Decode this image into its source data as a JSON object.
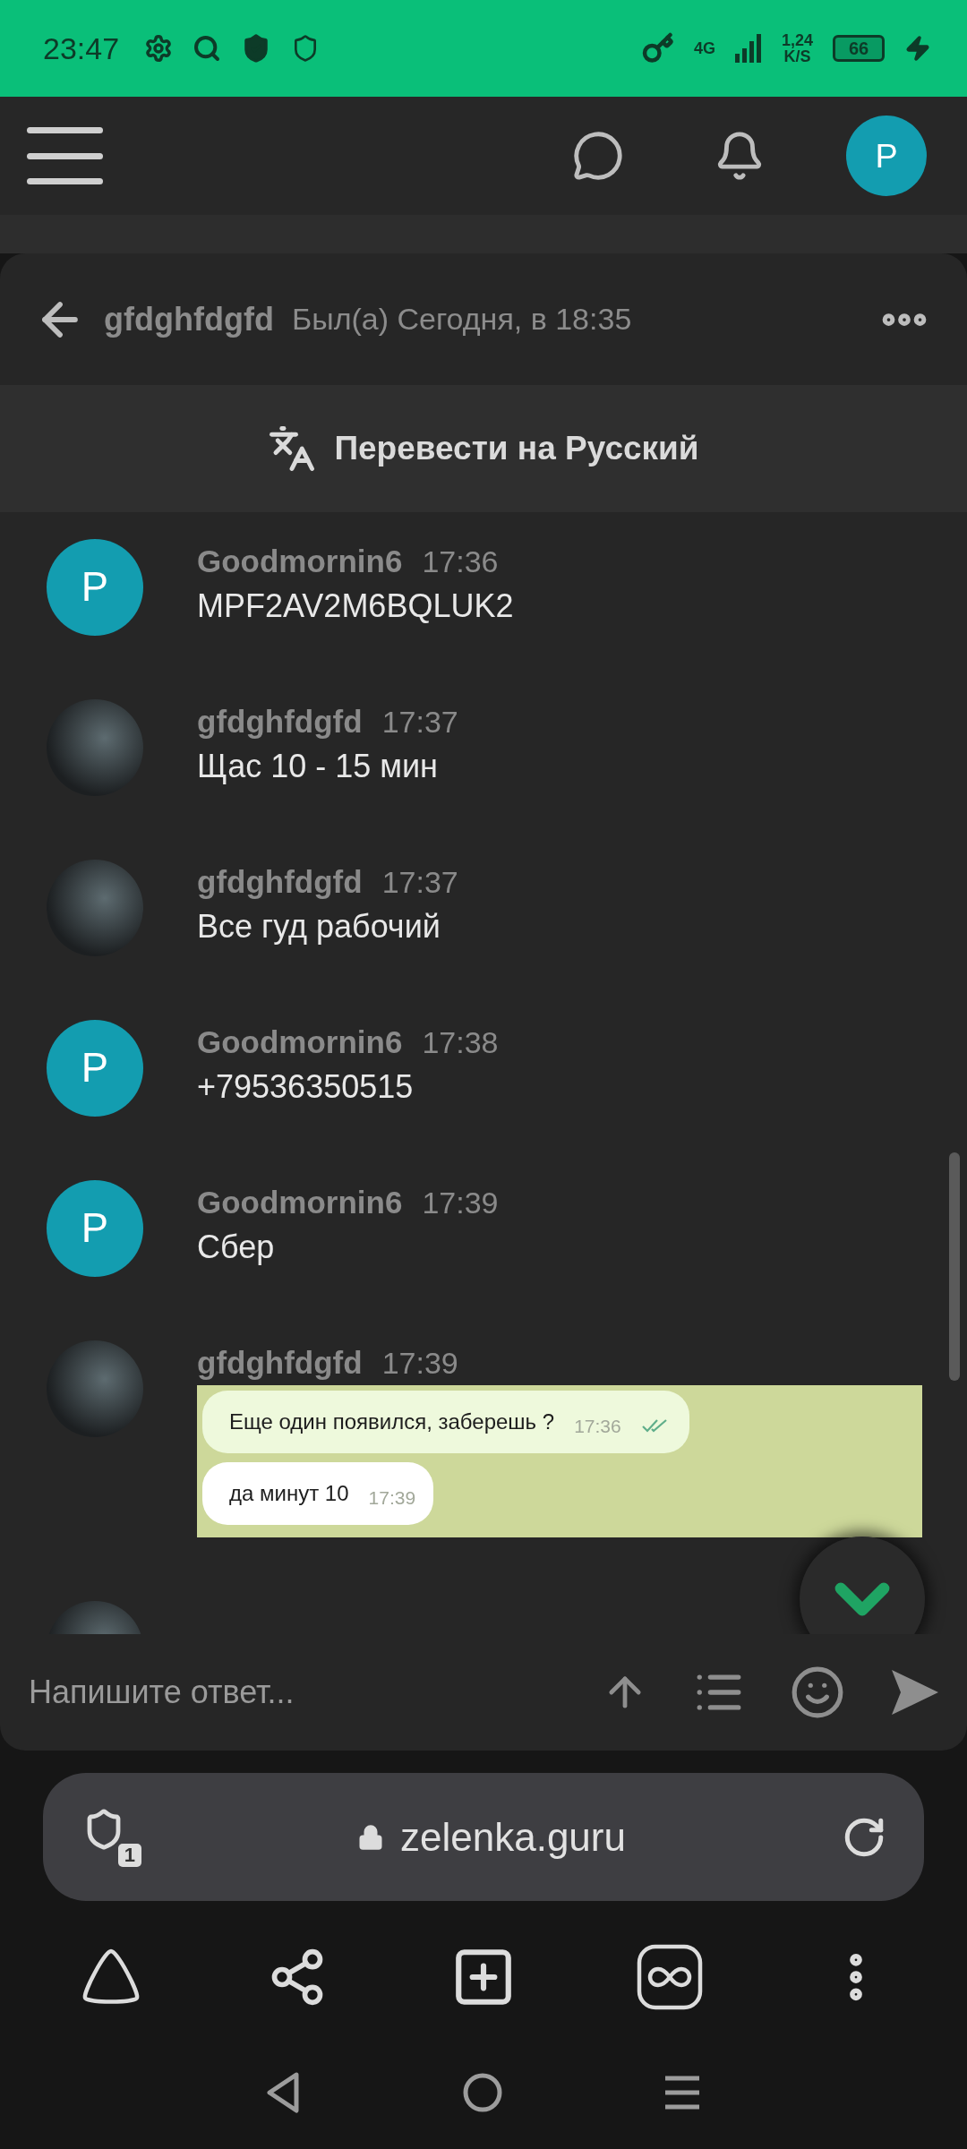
{
  "status_bar": {
    "time": "23:47",
    "network": "4G",
    "speed": "1,24",
    "speed_unit": "K/S",
    "battery": "66"
  },
  "header": {
    "avatar_letter": "P"
  },
  "conversation": {
    "name": "gfdghfdgfd",
    "last_seen": "Был(а) Сегодня, в 18:35"
  },
  "translate_button": "Перевести на Русский",
  "messages": [
    {
      "author": "Goodmornin6",
      "time": "17:36",
      "avatar": {
        "kind": "letter",
        "letter": "P"
      },
      "kind": "text",
      "text": "MPF2AV2M6BQLUK2"
    },
    {
      "author": "gfdghfdgfd",
      "time": "17:37",
      "avatar": {
        "kind": "photo"
      },
      "kind": "text",
      "text": "Щас 10 - 15 мин"
    },
    {
      "author": "gfdghfdgfd",
      "time": "17:37",
      "avatar": {
        "kind": "photo"
      },
      "kind": "text",
      "text": "Все гуд рабочий"
    },
    {
      "author": "Goodmornin6",
      "time": "17:38",
      "avatar": {
        "kind": "letter",
        "letter": "P"
      },
      "kind": "text",
      "text": "+79536350515"
    },
    {
      "author": "Goodmornin6",
      "time": "17:39",
      "avatar": {
        "kind": "letter",
        "letter": "P"
      },
      "kind": "text",
      "text": "Сбер"
    },
    {
      "author": "gfdghfdgfd",
      "time": "17:39",
      "avatar": {
        "kind": "photo"
      },
      "kind": "image",
      "bubbles": [
        {
          "text": "Еще один появился, заберешь ?",
          "time": "17:36",
          "outgoing": true,
          "read": true
        },
        {
          "text": "да минут 10",
          "time": "17:39",
          "outgoing": false,
          "read": false
        }
      ]
    },
    {
      "avatar": {
        "kind": "photo"
      },
      "kind": "cut"
    }
  ],
  "reply": {
    "placeholder": "Напишите ответ..."
  },
  "browser": {
    "url": "zelenka.guru",
    "tab_count": "1"
  }
}
